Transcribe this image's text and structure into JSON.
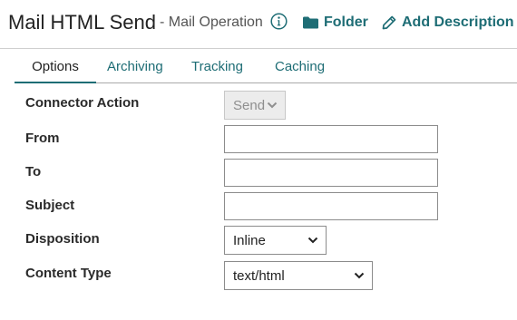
{
  "header": {
    "title": "Mail HTML Send",
    "subtitle": "- Mail Operation",
    "folder_label": "Folder",
    "add_description_label": "Add Description"
  },
  "tabs": [
    {
      "label": "Options",
      "active": true
    },
    {
      "label": "Archiving",
      "active": false
    },
    {
      "label": "Tracking",
      "active": false
    },
    {
      "label": "Caching",
      "active": false
    }
  ],
  "form": {
    "connector_action": {
      "label": "Connector Action",
      "value": "Send",
      "disabled": true
    },
    "from": {
      "label": "From",
      "value": ""
    },
    "to": {
      "label": "To",
      "value": ""
    },
    "subject": {
      "label": "Subject",
      "value": ""
    },
    "disposition": {
      "label": "Disposition",
      "value": "Inline"
    },
    "content_type": {
      "label": "Content Type",
      "value": "text/html"
    }
  },
  "colors": {
    "accent": "#1e6d75",
    "text": "#222222",
    "border": "#8c8c8c",
    "disabled_bg": "#ececec"
  }
}
